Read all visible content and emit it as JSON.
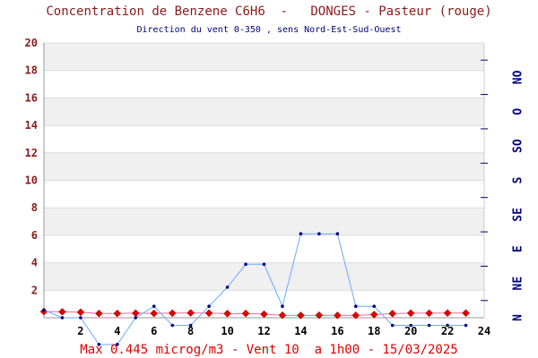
{
  "header": {
    "title": "Concentration de Benzene C6H6  -   DONGES - Pasteur (rouge)",
    "subtitle": "Direction du vent 0-350 , sens Nord-Est-Sud-Ouest"
  },
  "footer": {
    "text": "Max 0.445 microg/m3 - Vent 10  a 1h00 - 15/03/2025"
  },
  "colors": {
    "benzene_line": "#ff6699",
    "benzene_marker": "#dd0000",
    "wind_line": "#66aaff",
    "wind_marker": "#000080",
    "band": "#f0f0f0"
  },
  "chart_data": {
    "type": "line",
    "x_range": [
      0,
      24
    ],
    "y_range": [
      0,
      20
    ],
    "y_ticks": [
      2,
      4,
      6,
      8,
      10,
      12,
      14,
      16,
      18,
      20
    ],
    "x_ticks": [
      2,
      4,
      6,
      8,
      10,
      12,
      14,
      16,
      18,
      20,
      22,
      24
    ],
    "right_axis": {
      "range": [
        0,
        360
      ],
      "labels": [
        "N",
        "NE",
        "E",
        "SE",
        "S",
        "SO",
        "O",
        "NO"
      ]
    },
    "series": [
      {
        "axis": "left",
        "x": [
          0,
          1,
          2,
          3,
          4,
          5,
          6,
          7,
          8,
          9,
          10,
          11,
          12,
          13,
          14,
          15,
          16,
          17,
          18,
          19,
          20,
          21,
          22,
          23
        ],
        "values": [
          0.445,
          0.43,
          0.4,
          0.31,
          0.31,
          0.33,
          0.32,
          0.33,
          0.35,
          0.33,
          0.3,
          0.31,
          0.26,
          0.18,
          0.17,
          0.18,
          0.17,
          0.17,
          0.23,
          0.3,
          0.33,
          0.33,
          0.34,
          0.34
        ]
      },
      {
        "axis": "right",
        "x": [
          0,
          1,
          2,
          3,
          4,
          5,
          6,
          7,
          8,
          9,
          10,
          11,
          12,
          13,
          14,
          15,
          16,
          17,
          18,
          19,
          20,
          21,
          22,
          23
        ],
        "values": [
          10,
          0,
          0,
          -35,
          -35,
          0,
          15,
          -10,
          -10,
          15,
          40,
          70,
          70,
          15,
          110,
          110,
          110,
          15,
          15,
          -10,
          -10,
          -10,
          -10,
          -10
        ]
      }
    ]
  }
}
